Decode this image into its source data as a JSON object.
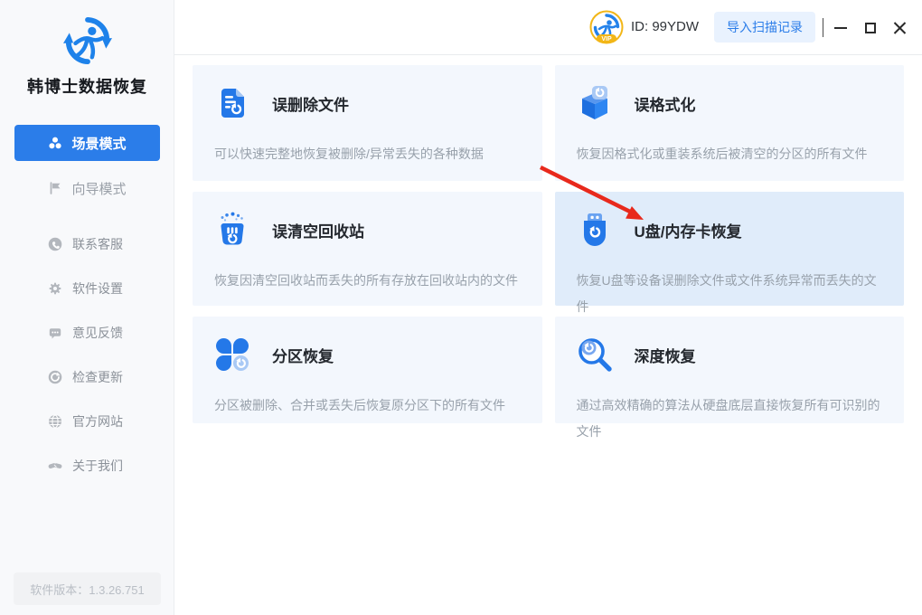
{
  "brand": {
    "app_name": "韩博士数据恢复"
  },
  "topbar": {
    "vip_text": "VIP",
    "user_id": "ID: 99YDW",
    "import_button": "导入扫描记录"
  },
  "sidebar": {
    "modes": [
      {
        "label": "场景模式",
        "icon": "scenes-icon",
        "active": true
      },
      {
        "label": "向导模式",
        "icon": "flag-icon",
        "active": false
      }
    ],
    "menu": [
      {
        "label": "联系客服",
        "icon": "phone-icon"
      },
      {
        "label": "软件设置",
        "icon": "gear-icon"
      },
      {
        "label": "意见反馈",
        "icon": "feedback-icon"
      },
      {
        "label": "检查更新",
        "icon": "update-icon"
      },
      {
        "label": "官方网站",
        "icon": "globe-icon"
      },
      {
        "label": "关于我们",
        "icon": "handshake-icon"
      }
    ],
    "version": "软件版本：1.3.26.751"
  },
  "cards": [
    {
      "title": "误删除文件",
      "desc": "可以快速完整地恢复被删除/异常丢失的各种数据",
      "icon": "deleted-file-icon",
      "highlighted": false
    },
    {
      "title": "误格式化",
      "desc": "恢复因格式化或重装系统后被清空的分区的所有文件",
      "icon": "formatted-icon",
      "highlighted": false
    },
    {
      "title": "误清空回收站",
      "desc": "恢复因清空回收站而丢失的所有存放在回收站内的文件",
      "icon": "recycle-bin-icon",
      "highlighted": false
    },
    {
      "title": "U盘/内存卡恢复",
      "desc": "恢复U盘等设备误删除文件或文件系统异常而丢失的文件",
      "icon": "usb-icon",
      "highlighted": true
    },
    {
      "title": "分区恢复",
      "desc": "分区被删除、合并或丢失后恢复原分区下的所有文件",
      "icon": "partition-icon",
      "highlighted": false
    },
    {
      "title": "深度恢复",
      "desc": "通过高效精确的算法从硬盘底层直接恢复所有可识别的文件",
      "icon": "deep-scan-icon",
      "highlighted": false
    }
  ],
  "annotation": {
    "type": "red-arrow",
    "points_to": "U盘/内存卡恢复"
  },
  "colors": {
    "accent": "#2b7de9",
    "icon_blue": "#2478e8",
    "icon_blue_light": "#a9c9f5",
    "card_bg": "#f3f7fd",
    "card_bg_highlight": "#e0ecfa",
    "arrow_red": "#e8291c",
    "vip_gold": "#f2b617",
    "sidebar_bg": "#f8f9fb"
  }
}
